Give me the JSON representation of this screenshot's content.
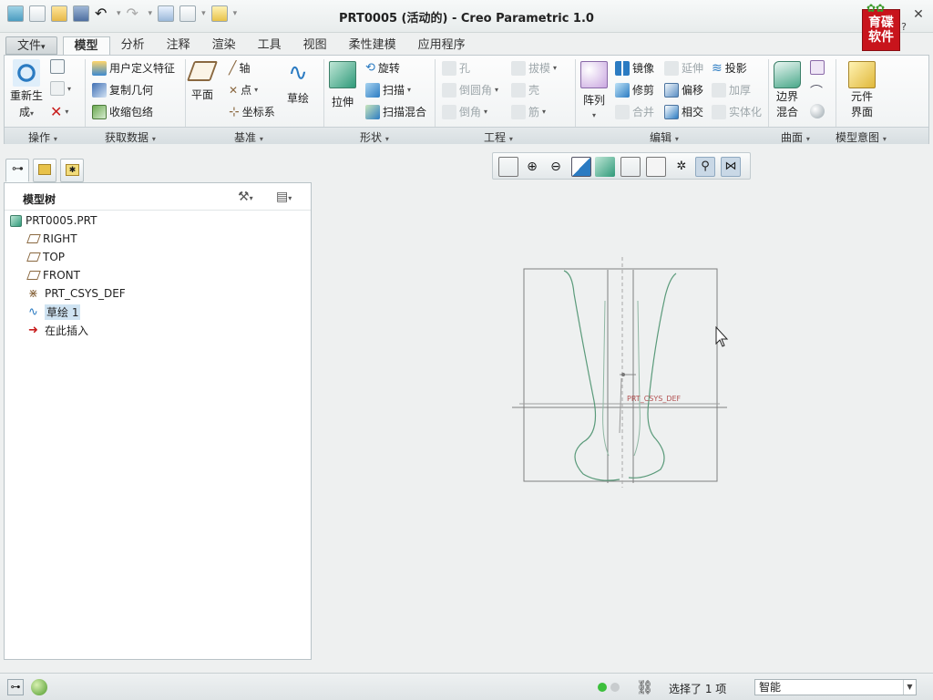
{
  "window": {
    "title": "PRT0005 (活动的) - Creo Parametric 1.0"
  },
  "quick_access": {
    "icons": [
      "layers-icon",
      "new-icon",
      "open-icon",
      "save-icon",
      "undo-icon",
      "redo-icon",
      "regenerate-icon",
      "windows-icon",
      "close-window-icon",
      "customize-icon"
    ]
  },
  "logo": {
    "text_top": "育碟",
    "text_bottom": "软件"
  },
  "tabs": [
    {
      "label": "文件",
      "arrow": "▾",
      "kind": "file"
    },
    {
      "label": "模型",
      "kind": "active"
    },
    {
      "label": "分析"
    },
    {
      "label": "注释"
    },
    {
      "label": "渲染"
    },
    {
      "label": "工具"
    },
    {
      "label": "视图"
    },
    {
      "label": "柔性建模"
    },
    {
      "label": "应用程序"
    }
  ],
  "ribbon": {
    "groups": {
      "operations": "操作",
      "get_data": "获取数据",
      "datum": "基准",
      "shapes": "形状",
      "engineering": "工程",
      "editing": "编辑",
      "surfaces": "曲面",
      "model_intent": "模型意图"
    },
    "buttons": {
      "regenerate_1": "重新生",
      "regenerate_2": "成",
      "user_defined_feature": "用户定义特征",
      "copy_geometry": "复制几何",
      "shrinkwrap": "收缩包络",
      "plane": "平面",
      "axis": "轴",
      "point": "点",
      "csys": "坐标系",
      "sketch": "草绘",
      "extrude": "拉伸",
      "revolve": "旋转",
      "sweep": "扫描",
      "swept_blend": "扫描混合",
      "hole": "孔",
      "round": "倒圆角",
      "chamfer": "倒角",
      "draft": "拔模",
      "shell": "壳",
      "rib": "筋",
      "pattern": "阵列",
      "mirror": "镜像",
      "trim": "修剪",
      "merge": "合并",
      "extend": "延伸",
      "offset": "偏移",
      "intersect": "相交",
      "project": "投影",
      "thicken": "加厚",
      "solidify": "实体化",
      "boundary_blend_1": "边界",
      "boundary_blend_2": "混合",
      "component_interface_1": "元件",
      "component_interface_2": "界面"
    }
  },
  "model_tree": {
    "title": "模型树",
    "nodes": [
      {
        "label": "PRT0005.PRT",
        "icon": "part-icon"
      },
      {
        "label": "RIGHT",
        "icon": "datum-plane-icon"
      },
      {
        "label": "TOP",
        "icon": "datum-plane-icon"
      },
      {
        "label": "FRONT",
        "icon": "datum-plane-icon"
      },
      {
        "label": "PRT_CSYS_DEF",
        "icon": "csys-icon"
      },
      {
        "label": "草绘 1",
        "icon": "sketch-icon",
        "selected": true
      },
      {
        "label": "在此插入",
        "icon": "insert-here-arrow-icon"
      }
    ]
  },
  "graphics": {
    "csys_label": "PRT_CSYS_DEF",
    "toolbar_icons": [
      "refit-icon",
      "zoom-in-icon",
      "zoom-out-icon",
      "repaint-icon",
      "display-style-icon",
      "saved-orientations-icon",
      "view-manager-icon",
      "datum-display-icon",
      "spin-center-icon",
      "annotation-display-icon",
      "csys-display-icon"
    ]
  },
  "status": {
    "message": "选择了 1 项",
    "filter_value": "智能"
  },
  "colors": {
    "accent": "#2b7bc2",
    "sketch": "#5a9a7a",
    "datum": "#9a6a40"
  }
}
